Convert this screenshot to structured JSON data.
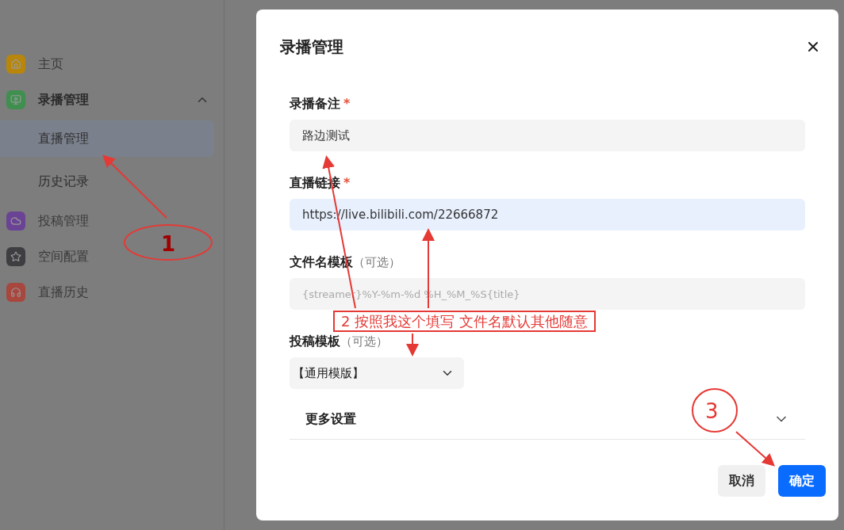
{
  "sidebar": {
    "items": [
      {
        "label": "主页",
        "color": "#b8860b"
      },
      {
        "label": "录播管理",
        "color": "#3f8f4f",
        "expanded": true,
        "children": [
          {
            "label": "直播管理",
            "selected": true
          },
          {
            "label": "历史记录",
            "selected": false
          }
        ]
      },
      {
        "label": "投稿管理",
        "color": "#6a4394"
      },
      {
        "label": "空间配置",
        "color": "#3d3d42"
      },
      {
        "label": "直播历史",
        "color": "#a8473e"
      }
    ]
  },
  "dialog": {
    "title": "录播管理",
    "fields": [
      {
        "kind": "text",
        "label": "录播备注",
        "required_mark": "*",
        "value": "路边测试",
        "focused": false
      },
      {
        "kind": "text",
        "label": "直播链接",
        "required_mark": "*",
        "value": "https://live.bilibili.com/22666872",
        "focused": true
      },
      {
        "kind": "text",
        "label": "文件名模板",
        "optional": "（可选）",
        "placeholder": "{streamer}%Y-%m-%d %H_%M_%S{title}",
        "focused": false
      },
      {
        "kind": "select",
        "label": "投稿模板",
        "optional": "（可选）",
        "value": "【通用模版】"
      }
    ],
    "more": {
      "label": "更多设置",
      "expanded": false
    },
    "buttons": [
      {
        "label": "取消",
        "kind": "secondary"
      },
      {
        "label": "确定",
        "kind": "primary"
      }
    ]
  },
  "annotations": [
    {
      "label": "1"
    },
    {
      "label": "2 按照我这个填写 文件名默认其他随意"
    },
    {
      "label": "3"
    }
  ]
}
